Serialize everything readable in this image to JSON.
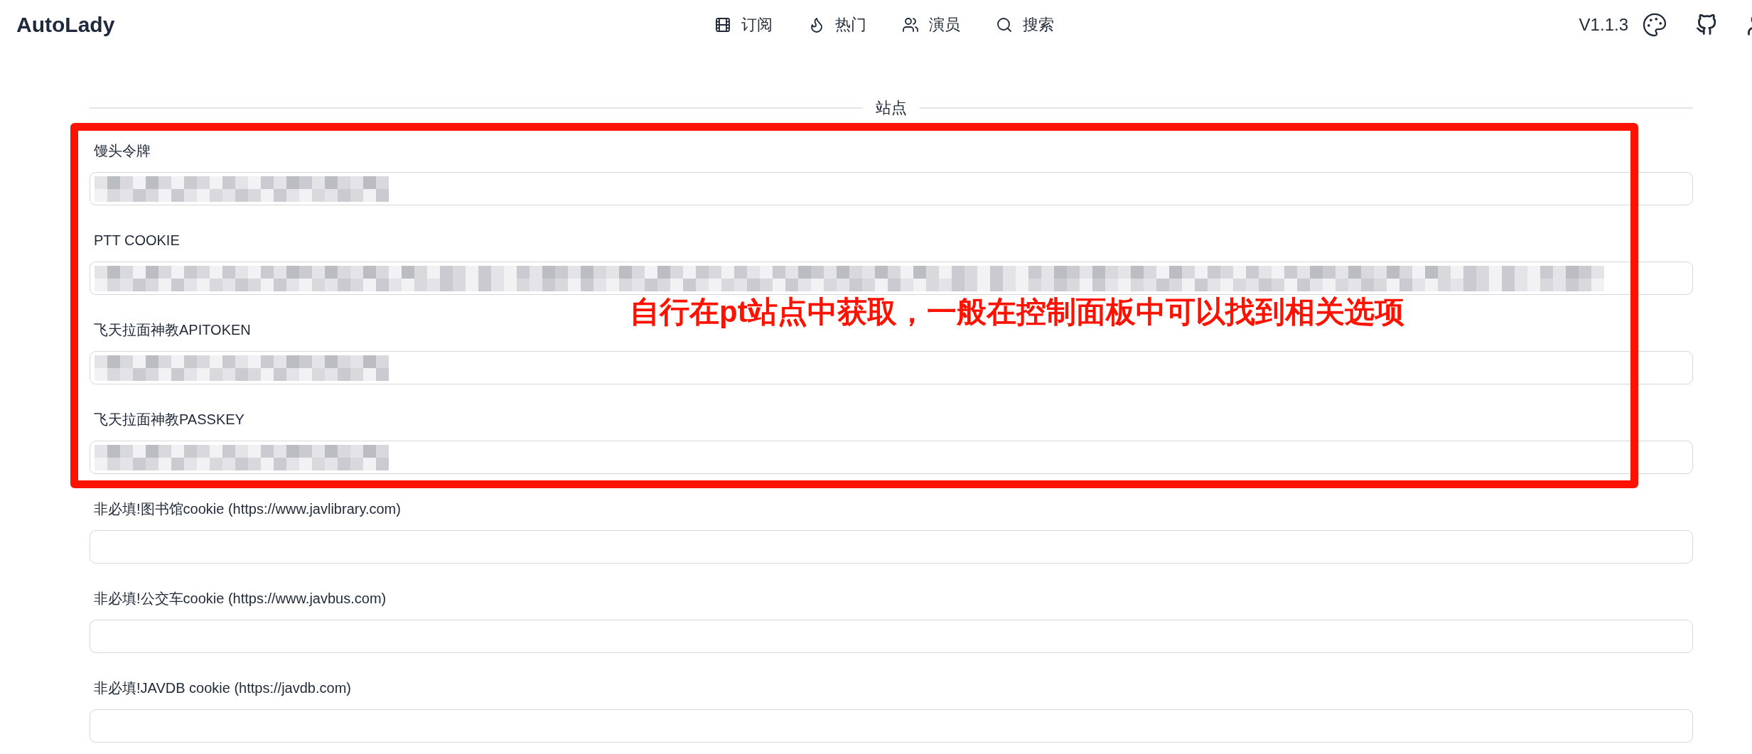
{
  "header": {
    "brand": "AutoLady",
    "nav": [
      "订阅",
      "热门",
      "演员",
      "搜索"
    ],
    "version": "V1.1.3"
  },
  "section": {
    "title": "站点",
    "fields": [
      {
        "label": "馒头令牌",
        "kind": "short"
      },
      {
        "label": "PTT COOKIE",
        "kind": "long"
      },
      {
        "label": "飞天拉面神教APITOKEN",
        "kind": "short"
      },
      {
        "label": "飞天拉面神教PASSKEY",
        "kind": "short"
      },
      {
        "label": "非必填!图书馆cookie (https://www.javlibrary.com)",
        "kind": "blank"
      },
      {
        "label": "非必填!公交车cookie (https://www.javbus.com)",
        "kind": "blank"
      },
      {
        "label": "非必填!JAVDB cookie (https://javdb.com)",
        "kind": "blank"
      }
    ]
  },
  "annotation": {
    "text": "自行在pt站点中获取，一般在控制面板中可以找到相关选项"
  }
}
